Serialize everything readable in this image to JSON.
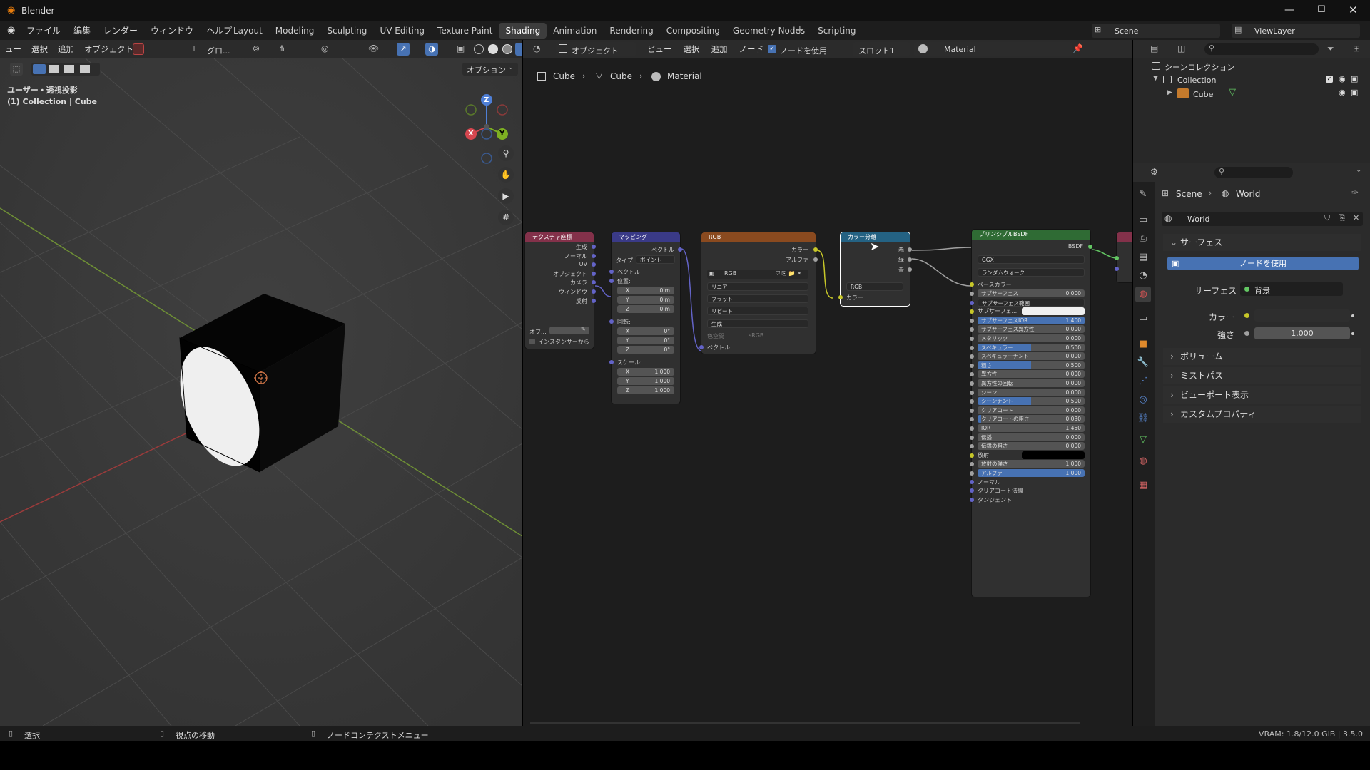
{
  "app": {
    "title": "Blender"
  },
  "menus": [
    "ファイル",
    "編集",
    "レンダー",
    "ウィンドウ",
    "ヘルプ"
  ],
  "workspaces": [
    {
      "label": "Layout",
      "active": false
    },
    {
      "label": "Modeling",
      "active": false
    },
    {
      "label": "Sculpting",
      "active": false
    },
    {
      "label": "UV Editing",
      "active": false
    },
    {
      "label": "Texture Paint",
      "active": false
    },
    {
      "label": "Shading",
      "active": true
    },
    {
      "label": "Animation",
      "active": false
    },
    {
      "label": "Rendering",
      "active": false
    },
    {
      "label": "Compositing",
      "active": false
    },
    {
      "label": "Geometry Nodes",
      "active": false
    },
    {
      "label": "Scripting",
      "active": false
    }
  ],
  "add_workspace": "+",
  "scene": {
    "name": "Scene",
    "viewlayer": "ViewLayer"
  },
  "viewport": {
    "menus": [
      "ュー",
      "選択",
      "追加",
      "オブジェクト"
    ],
    "transform": "グロ...",
    "options": "オプション",
    "overlay_line1": "ユーザー・透視投影",
    "overlay_line2": "(1) Collection | Cube",
    "gizmo": {
      "x": "X",
      "y": "Y",
      "z": "Z"
    }
  },
  "node_editor": {
    "object_mode": "オブジェクト",
    "menus": [
      "ビュー",
      "選択",
      "追加",
      "ノード"
    ],
    "use_nodes": "ノードを使用",
    "slot": "スロット1",
    "material": "Material",
    "breadcrumb": [
      "Cube",
      "Cube",
      "Material"
    ],
    "nodes": {
      "texcoord": {
        "title": "テクスチャ座標",
        "outputs": [
          "生成",
          "ノーマル",
          "UV",
          "オブジェクト",
          "カメラ",
          "ウィンドウ",
          "反射"
        ],
        "object_label": "オブ...",
        "from_instancer": "インスタンサーから"
      },
      "mapping": {
        "title": "マッピング",
        "out": "ベクトル",
        "type_label": "タイプ:",
        "type_value": "ポイント",
        "vector": "ベクトル",
        "location": "位置:",
        "loc": [
          "X",
          "0 m",
          "Y",
          "0 m",
          "Z",
          "0 m"
        ],
        "rotation": "回転:",
        "rot": [
          "X",
          "0°",
          "Y",
          "0°",
          "Z",
          "0°"
        ],
        "scale": "スケール:",
        "sca": [
          "X",
          "1.000",
          "Y",
          "1.000",
          "Z",
          "1.000"
        ]
      },
      "image": {
        "title": "RGB",
        "out_color": "カラー",
        "out_alpha": "アルファ",
        "image_name": "RGB",
        "interp": "リニア",
        "proj": "フラット",
        "ext": "リピート",
        "source": "生成",
        "colorspace_label": "色空間",
        "colorspace": "sRGB",
        "vector": "ベクトル"
      },
      "separate": {
        "title": "カラー分離",
        "outs": [
          "赤",
          "緑",
          "青"
        ],
        "mode": "RGB",
        "in": "カラー"
      },
      "bsdf": {
        "title": "プリンシプルBSDF",
        "out": "BSDF",
        "dist": "GGX",
        "ss_method": "ランダムウォーク",
        "base_color": "ベースカラー",
        "rows": [
          {
            "l": "サブサーフェス",
            "v": "0.000",
            "f": 0
          },
          {
            "l": "サブサーフェス範囲",
            "v": "",
            "f": 0,
            "dropdown": true
          },
          {
            "l": "サブサーフェ...",
            "v": "",
            "f": 0,
            "white": true
          },
          {
            "l": "サブサーフェスIOR",
            "v": "1.400",
            "f": 1
          },
          {
            "l": "サブサーフェス異方性",
            "v": "0.000",
            "f": 0
          },
          {
            "l": "メタリック",
            "v": "0.000",
            "f": 0
          },
          {
            "l": "スペキュラー",
            "v": "0.500",
            "f": 0.5
          },
          {
            "l": "スペキュラーチント",
            "v": "0.000",
            "f": 0
          },
          {
            "l": "粗さ",
            "v": "0.500",
            "f": 0.5
          },
          {
            "l": "異方性",
            "v": "0.000",
            "f": 0
          },
          {
            "l": "異方性の回転",
            "v": "0.000",
            "f": 0
          },
          {
            "l": "シーン",
            "v": "0.000",
            "f": 0
          },
          {
            "l": "シーンチント",
            "v": "0.500",
            "f": 0.5
          },
          {
            "l": "クリアコート",
            "v": "0.000",
            "f": 0
          },
          {
            "l": "クリアコートの粗さ",
            "v": "0.030",
            "f": 0.03
          },
          {
            "l": "IOR",
            "v": "1.450",
            "f": 0
          },
          {
            "l": "伝播",
            "v": "0.000",
            "f": 0
          },
          {
            "l": "伝播の粗さ",
            "v": "0.000",
            "f": 0
          },
          {
            "l": "放射",
            "v": "",
            "f": 0,
            "black": true
          },
          {
            "l": "放射の強さ",
            "v": "1.000",
            "f": 0
          },
          {
            "l": "アルファ",
            "v": "1.000",
            "f": 1
          }
        ],
        "inputs_tail": [
          "ノーマル",
          "クリアコート法線",
          "タンジェント"
        ]
      }
    }
  },
  "outliner": {
    "scene_collection": "シーンコレクション",
    "collection": "Collection",
    "cube": "Cube"
  },
  "properties": {
    "breadcrumb": [
      "Scene",
      "World"
    ],
    "world": "World",
    "surface_panel": "サーフェス",
    "use_nodes": "ノードを使用",
    "surface_label": "サーフェス",
    "surface_value": "背景",
    "color_label": "カラー",
    "strength_label": "強さ",
    "strength_value": "1.000",
    "panels": [
      "ボリューム",
      "ミストパス",
      "ビューポート表示",
      "カスタムプロパティ"
    ]
  },
  "statusbar": {
    "items": [
      "選択",
      "視点の移動",
      "ノードコンテクストメニュー"
    ],
    "vram": "VRAM: 1.8/12.0 GiB | 3.5.0"
  },
  "colors": {
    "accent": "#4772b3",
    "grid": "#393939",
    "title": "#111111"
  }
}
